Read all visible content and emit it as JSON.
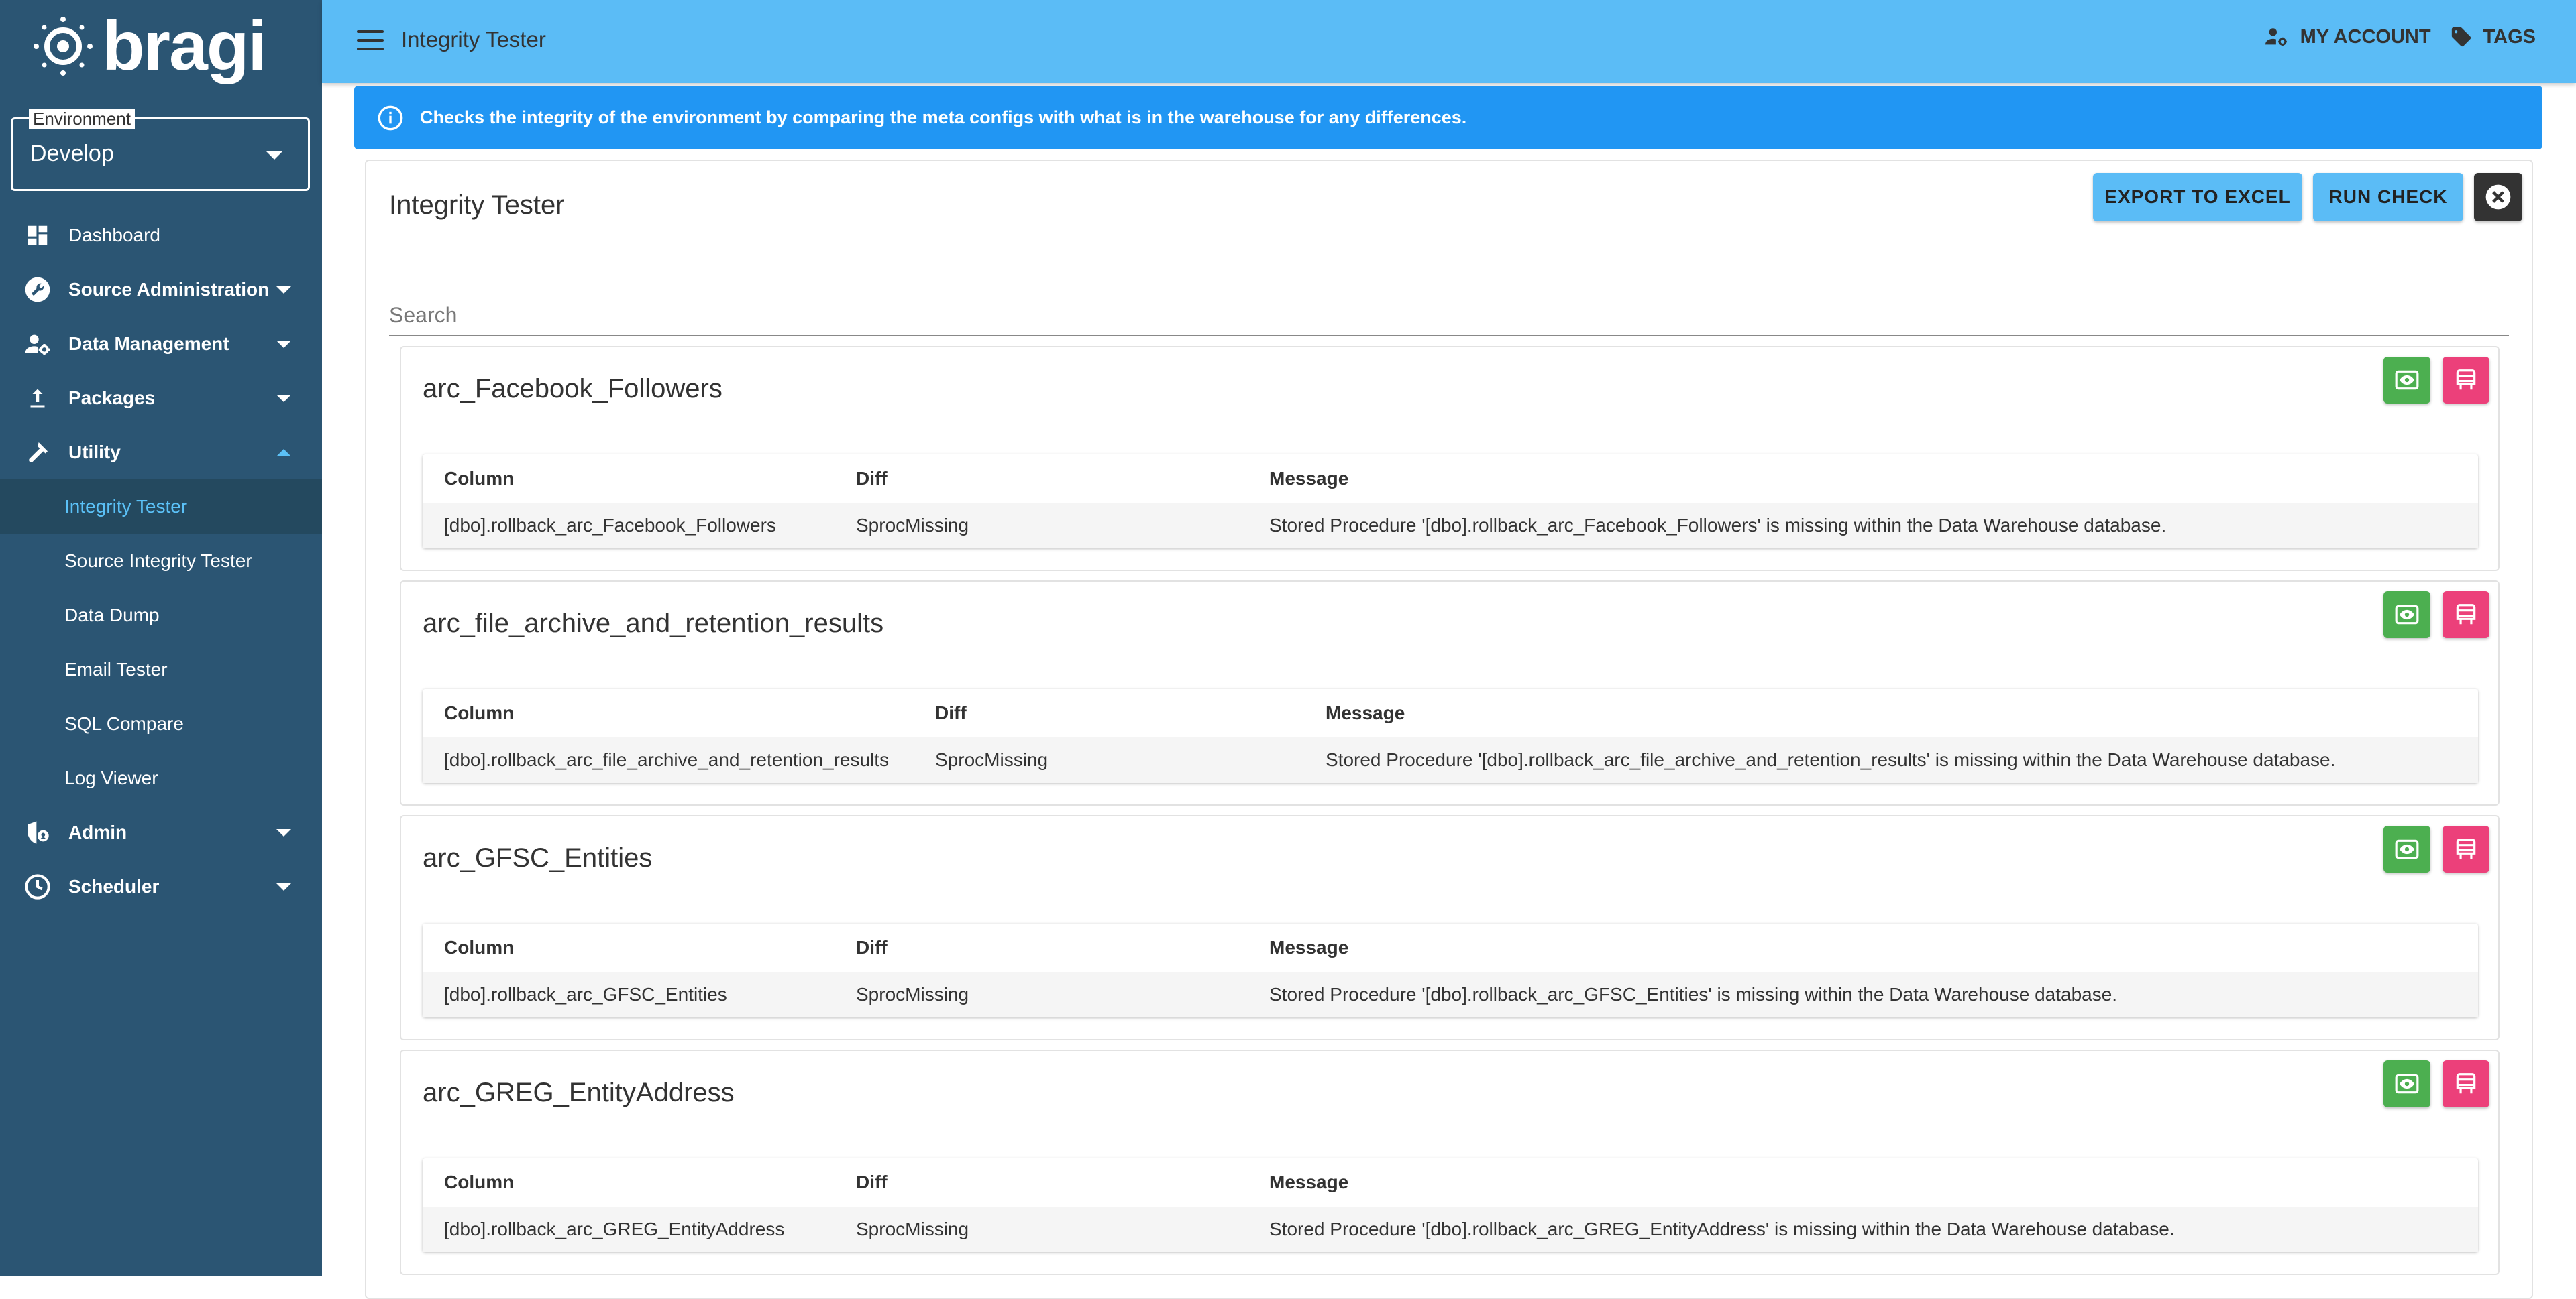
{
  "app": {
    "logo_text": "bragi",
    "page_title": "Integrity Tester"
  },
  "environment": {
    "label": "Environment",
    "value": "Develop"
  },
  "sidebar": {
    "items": [
      {
        "label": "Dashboard",
        "icon": "dashboard-icon"
      },
      {
        "label": "Source Administration",
        "icon": "wrench-icon"
      },
      {
        "label": "Data Management",
        "icon": "user-gear-icon"
      },
      {
        "label": "Packages",
        "icon": "upload-icon"
      },
      {
        "label": "Utility",
        "icon": "hammer-icon"
      },
      {
        "label": "Integrity Tester"
      },
      {
        "label": "Source Integrity Tester"
      },
      {
        "label": "Data Dump"
      },
      {
        "label": "Email Tester"
      },
      {
        "label": "SQL Compare"
      },
      {
        "label": "Log Viewer"
      },
      {
        "label": "Admin",
        "icon": "shield-user-icon"
      },
      {
        "label": "Scheduler",
        "icon": "clock-icon"
      }
    ]
  },
  "topbar": {
    "title": "Integrity Tester",
    "my_account": "MY ACCOUNT",
    "tags": "TAGS"
  },
  "banner": {
    "text": "Checks the integrity of the environment by comparing the meta configs with what is in the warehouse for any differences."
  },
  "main": {
    "title": "Integrity Tester",
    "export_label": "EXPORT TO EXCEL",
    "run_label": "RUN CHECK",
    "search_placeholder": "Search",
    "columns": {
      "column": "Column",
      "diff": "Diff",
      "message": "Message"
    },
    "sections": [
      {
        "title": "arc_Facebook_Followers",
        "row": {
          "column": "[dbo].rollback_arc_Facebook_Followers",
          "diff": "SprocMissing",
          "message": "Stored Procedure '[dbo].rollback_arc_Facebook_Followers' is missing within the Data Warehouse database."
        }
      },
      {
        "title": "arc_file_archive_and_retention_results",
        "row": {
          "column": "[dbo].rollback_arc_file_archive_and_retention_results",
          "diff": "SprocMissing",
          "message": "Stored Procedure '[dbo].rollback_arc_file_archive_and_retention_results' is missing within the Data Warehouse database."
        }
      },
      {
        "title": "arc_GFSC_Entities",
        "row": {
          "column": "[dbo].rollback_arc_GFSC_Entities",
          "diff": "SprocMissing",
          "message": "Stored Procedure '[dbo].rollback_arc_GFSC_Entities' is missing within the Data Warehouse database."
        }
      },
      {
        "title": "arc_GREG_EntityAddress",
        "row": {
          "column": "[dbo].rollback_arc_GREG_EntityAddress",
          "diff": "SprocMissing",
          "message": "Stored Procedure '[dbo].rollback_arc_GREG_EntityAddress' is missing within the Data Warehouse database."
        }
      }
    ]
  },
  "colors": {
    "sidebar_bg": "#2b5573",
    "topbar_bg": "#5bbcf6",
    "banner_bg": "#2196f3",
    "active_text": "#5bc1f7",
    "view_button": "#4caf50",
    "remove_button": "#ec407a"
  }
}
